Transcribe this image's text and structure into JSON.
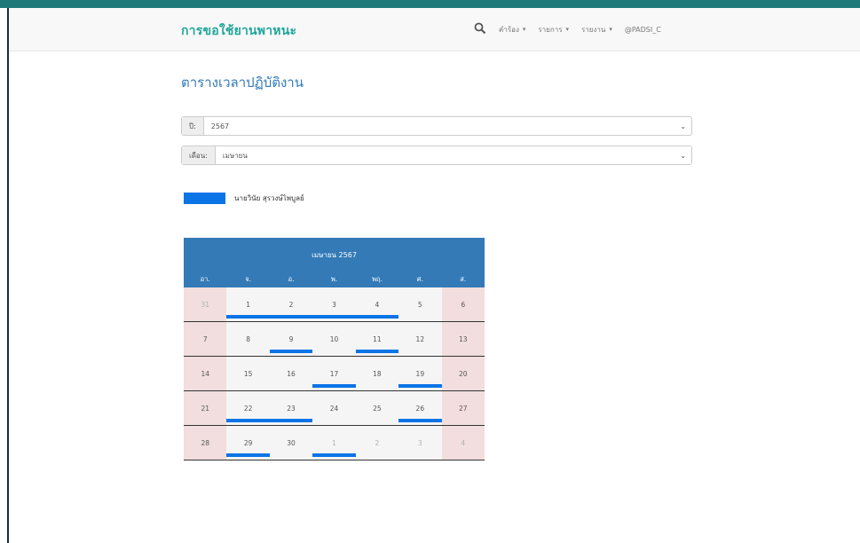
{
  "navbar": {
    "brand": "การขอใช้ยานพาหนะ",
    "items": [
      {
        "label": "คำร้อง"
      },
      {
        "label": "รายการ"
      },
      {
        "label": "รายงาน"
      }
    ],
    "user": "@PADSI_C"
  },
  "page_title": "ตารางเวลาปฏิบัติงาน",
  "year_field": {
    "label": "ปี:",
    "value": "2567"
  },
  "month_field": {
    "label": "เดือน:",
    "value": "เมษายน"
  },
  "legend": {
    "label": "นายวินัย สุรวงษ์ไพบูลย์",
    "color": "#0b74e6"
  },
  "calendar": {
    "title": "เมษายน 2567",
    "weekdays": [
      "อา.",
      "จ.",
      "อ.",
      "พ.",
      "พฤ.",
      "ศ.",
      "ส."
    ],
    "weeks": [
      {
        "days": [
          {
            "d": "31",
            "other": true,
            "bar": false
          },
          {
            "d": "1",
            "bar": true
          },
          {
            "d": "2",
            "bar": true
          },
          {
            "d": "3",
            "bar": true
          },
          {
            "d": "4",
            "bar": true
          },
          {
            "d": "5",
            "bar": false
          },
          {
            "d": "6",
            "bar": false
          }
        ]
      },
      {
        "days": [
          {
            "d": "7",
            "bar": false
          },
          {
            "d": "8",
            "bar": false
          },
          {
            "d": "9",
            "bar": true
          },
          {
            "d": "10",
            "bar": false
          },
          {
            "d": "11",
            "bar": true
          },
          {
            "d": "12",
            "bar": false
          },
          {
            "d": "13",
            "bar": false
          }
        ]
      },
      {
        "days": [
          {
            "d": "14",
            "bar": false
          },
          {
            "d": "15",
            "bar": false
          },
          {
            "d": "16",
            "bar": false
          },
          {
            "d": "17",
            "bar": true
          },
          {
            "d": "18",
            "bar": false
          },
          {
            "d": "19",
            "bar": true
          },
          {
            "d": "20",
            "bar": false
          }
        ]
      },
      {
        "days": [
          {
            "d": "21",
            "bar": false
          },
          {
            "d": "22",
            "bar": true
          },
          {
            "d": "23",
            "bar": true
          },
          {
            "d": "24",
            "bar": false
          },
          {
            "d": "25",
            "bar": false
          },
          {
            "d": "26",
            "bar": true
          },
          {
            "d": "27",
            "bar": false
          }
        ]
      },
      {
        "days": [
          {
            "d": "28",
            "bar": false
          },
          {
            "d": "29",
            "bar": true
          },
          {
            "d": "30",
            "bar": false
          },
          {
            "d": "1",
            "other": true,
            "bar": true
          },
          {
            "d": "2",
            "other": true,
            "bar": false
          },
          {
            "d": "3",
            "other": true,
            "bar": false
          },
          {
            "d": "4",
            "other": true,
            "bar": false
          }
        ]
      }
    ]
  },
  "colors": {
    "brand": "#1fa69a",
    "header": "#337ab7",
    "weekend": "#f2dede",
    "event_bar": "#0b74e6"
  },
  "icons": {
    "search": "search-icon",
    "dropdown": "chevron-down-icon"
  }
}
